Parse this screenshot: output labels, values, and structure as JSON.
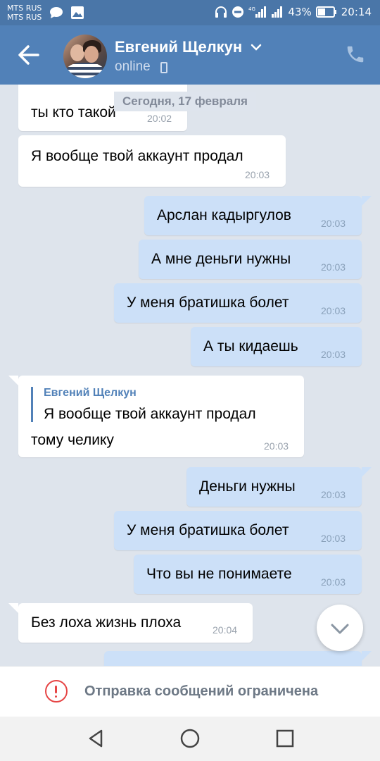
{
  "status_bar": {
    "carrier_1": "MTS RUS",
    "carrier_2": "MTS RUS",
    "battery": "43%",
    "time": "20:14",
    "icons": [
      "chat-bubble-icon",
      "image-icon",
      "headphones-icon",
      "do-not-disturb-icon",
      "signal-4g-icon",
      "signal-icon",
      "battery-icon"
    ]
  },
  "header": {
    "contact_name": "Евгений Щелкун",
    "status": "online",
    "accent_color": "#5181b8"
  },
  "chat": {
    "date_separator": "Сегодня, 17 февраля",
    "messages": [
      {
        "direction": "in",
        "text": "ты кто такой",
        "time": "20:02"
      },
      {
        "direction": "in",
        "text": "Я вообще твой аккаунт продал",
        "time": "20:03"
      },
      {
        "direction": "out",
        "text": "Арслан кадыргулов",
        "time": "20:03"
      },
      {
        "direction": "out",
        "text": "А мне деньги нужны",
        "time": "20:03"
      },
      {
        "direction": "out",
        "text": "У меня братишка болет",
        "time": "20:03"
      },
      {
        "direction": "out",
        "text": "А ты кидаешь",
        "time": "20:03"
      },
      {
        "direction": "in",
        "quote_author": "Евгений Щелкун",
        "text_line1": "Я вообще твой аккаунт продал",
        "text_line2": "тому челику",
        "time": "20:03"
      },
      {
        "direction": "out",
        "text": "Деньги нужны",
        "time": "20:03"
      },
      {
        "direction": "out",
        "text": "У меня братишка болет",
        "time": "20:03"
      },
      {
        "direction": "out",
        "text": "Что вы не понимаете",
        "time": "20:03"
      },
      {
        "direction": "in",
        "text": "Без лоха жизнь плоха",
        "time": "20:04"
      }
    ]
  },
  "restriction": {
    "text": "Отправка сообщений ограничена",
    "icon": "warning-circle-icon",
    "color": "#e64646"
  },
  "navbar": {
    "buttons": [
      "back-triangle-icon",
      "home-circle-icon",
      "recents-square-icon"
    ]
  }
}
